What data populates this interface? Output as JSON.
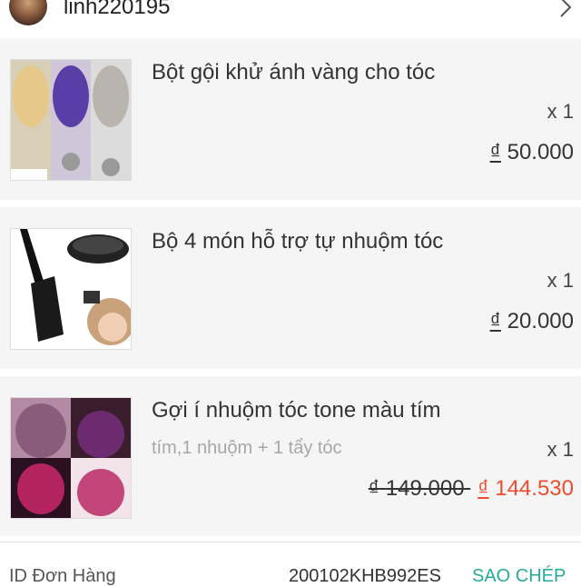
{
  "shop": {
    "name": "linh220195",
    "avatar_icon": "avatar-icon",
    "chevron_icon": "chevron-right-icon"
  },
  "items": [
    {
      "name": "Bột gội khử ánh vàng cho tóc",
      "quantity": "x 1",
      "currency": "₫",
      "price": "50.000"
    },
    {
      "name": "Bộ 4 món hỗ trợ tự nhuộm tóc",
      "quantity": "x 1",
      "currency": "₫",
      "price": "20.000"
    },
    {
      "name": "Gợi í nhuộm tóc tone màu tím",
      "variant": "tím,1 nhuộm + 1 tẩy tóc",
      "quantity": "x 1",
      "currency": "₫",
      "original_price": "149.000",
      "price": "144.530"
    }
  ],
  "order": {
    "label": "ID Đơn Hàng",
    "id": "200102KHB992ES",
    "copy_label": "SAO CHÉP"
  },
  "colors": {
    "accent": "#ee4d2d",
    "copy": "#26aa99",
    "item_bg": "#f5f5f5"
  }
}
